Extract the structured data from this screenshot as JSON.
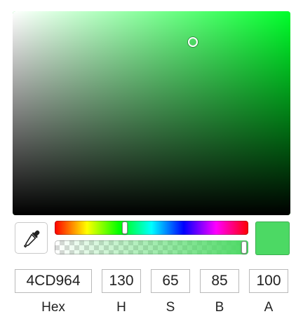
{
  "picker": {
    "hue": 130,
    "saturation_percent": 65,
    "brightness_percent": 85,
    "alpha_percent": 100,
    "hue_color": "#00ff2b",
    "selected_color": "#4CD964"
  },
  "icons": {
    "eyedropper": "eyedropper-icon"
  },
  "fields": {
    "hex": {
      "value": "4CD964",
      "label": "Hex"
    },
    "h": {
      "value": "130",
      "label": "H"
    },
    "s": {
      "value": "65",
      "label": "S"
    },
    "b": {
      "value": "85",
      "label": "B"
    },
    "a": {
      "value": "100",
      "label": "A"
    }
  }
}
